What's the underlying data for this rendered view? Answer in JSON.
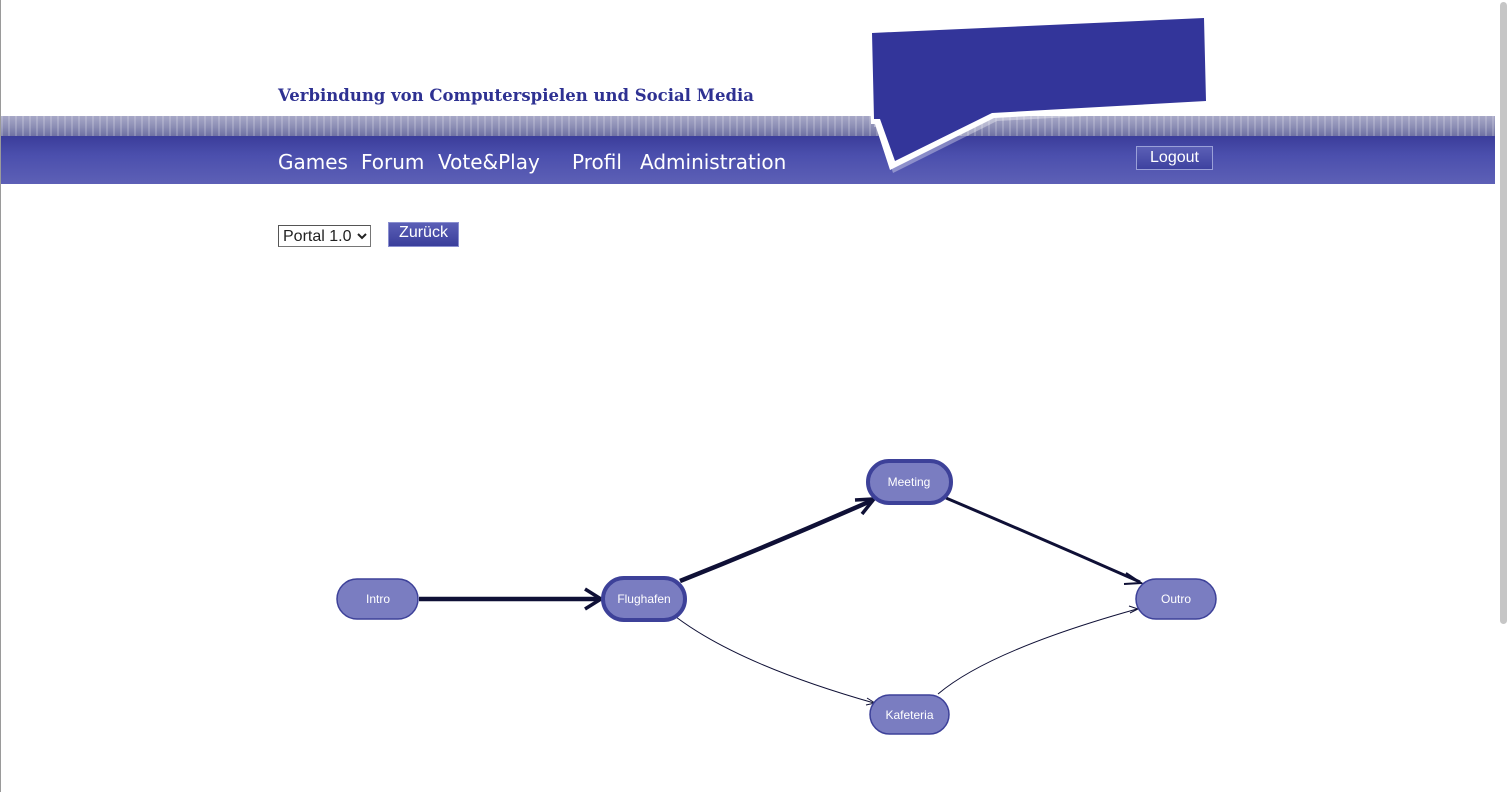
{
  "header": {
    "site_title": "Verbindung von Computerspielen und Social Media",
    "nav": [
      "Games",
      "Forum",
      "Vote&Play",
      "Profil",
      "Administration"
    ],
    "logout_label": "Logout"
  },
  "toolbar": {
    "version_options": [
      "Portal 1.0"
    ],
    "selected_version": "Portal 1.0",
    "back_label": "Zurück"
  },
  "flow": {
    "nodes": [
      {
        "id": "intro",
        "label": "Intro"
      },
      {
        "id": "flughafen",
        "label": "Flughafen",
        "highlight": true
      },
      {
        "id": "meeting",
        "label": "Meeting",
        "highlight": true
      },
      {
        "id": "kafeteria",
        "label": "Kafeteria"
      },
      {
        "id": "outro",
        "label": "Outro"
      }
    ],
    "edges": [
      {
        "from": "intro",
        "to": "flughafen",
        "weight": "bold"
      },
      {
        "from": "flughafen",
        "to": "meeting",
        "weight": "bold"
      },
      {
        "from": "meeting",
        "to": "outro",
        "weight": "medium"
      },
      {
        "from": "flughafen",
        "to": "kafeteria",
        "weight": "thin"
      },
      {
        "from": "kafeteria",
        "to": "outro",
        "weight": "thin"
      }
    ]
  },
  "colors": {
    "brand": "#2e3192",
    "node_fill": "#7a7dc1",
    "node_border": "#3d4199",
    "edge": "#0f1036"
  }
}
